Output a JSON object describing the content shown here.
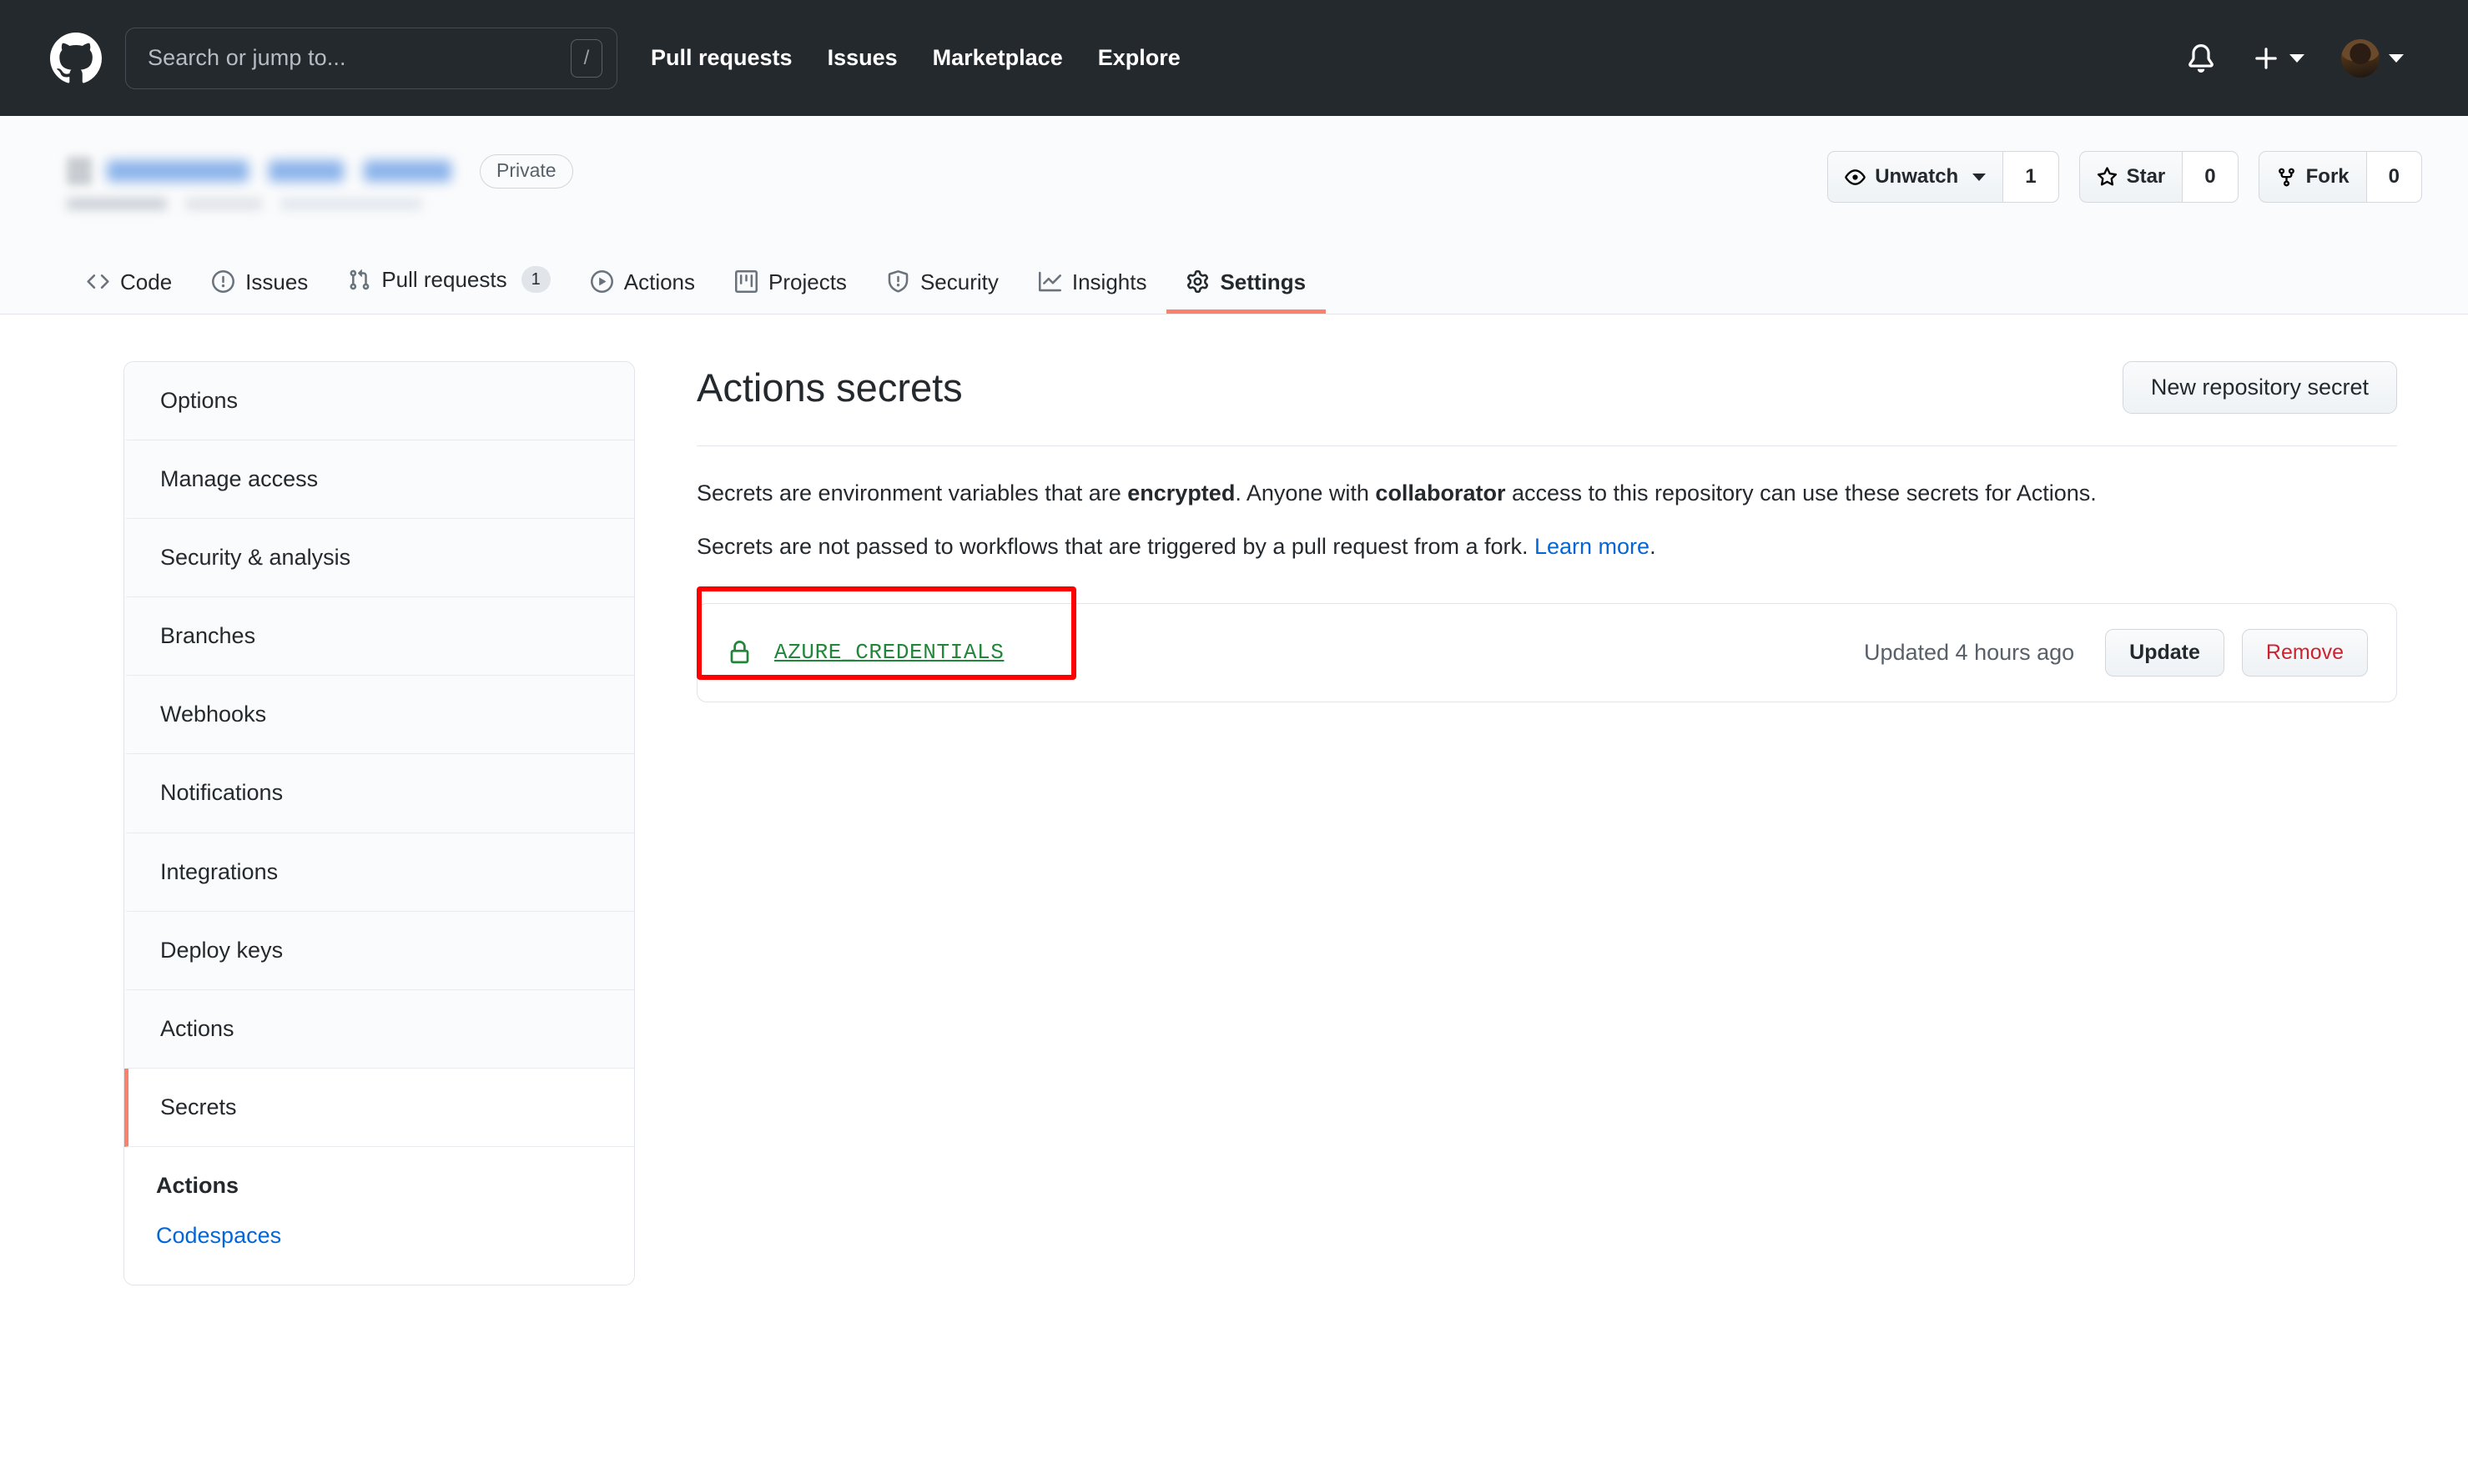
{
  "header": {
    "logo_icon": "github-mark-icon",
    "search": {
      "placeholder": "Search or jump to...",
      "value": "",
      "shortcut_key": "/"
    },
    "nav": [
      {
        "label": "Pull requests"
      },
      {
        "label": "Issues"
      },
      {
        "label": "Marketplace"
      },
      {
        "label": "Explore"
      }
    ],
    "notifications_icon": "bell-icon",
    "create_new_icon": "plus-icon",
    "create_new_caret": "chevron-down-icon",
    "avatar_icon": "user-avatar",
    "avatar_caret": "chevron-down-icon"
  },
  "repo": {
    "visibility_badge": "Private",
    "name_redacted": true,
    "description_redacted": true,
    "actions": [
      {
        "name": "watch",
        "icon": "eye-icon",
        "label": "Unwatch",
        "has_caret": true,
        "count": "1"
      },
      {
        "name": "star",
        "icon": "star-icon",
        "label": "Star",
        "has_caret": false,
        "count": "0"
      },
      {
        "name": "fork",
        "icon": "repo-forked-icon",
        "label": "Fork",
        "has_caret": false,
        "count": "0"
      }
    ],
    "tabs": [
      {
        "label": "Code",
        "icon": "code-icon",
        "badge": "",
        "active": false
      },
      {
        "label": "Issues",
        "icon": "issue-opened-icon",
        "badge": "",
        "active": false
      },
      {
        "label": "Pull requests",
        "icon": "git-pull-request-icon",
        "badge": "1",
        "active": false
      },
      {
        "label": "Actions",
        "icon": "play-icon",
        "badge": "",
        "active": false
      },
      {
        "label": "Projects",
        "icon": "project-icon",
        "badge": "",
        "active": false
      },
      {
        "label": "Security",
        "icon": "shield-icon",
        "badge": "",
        "active": false
      },
      {
        "label": "Insights",
        "icon": "graph-icon",
        "badge": "",
        "active": false
      },
      {
        "label": "Settings",
        "icon": "gear-icon",
        "badge": "",
        "active": true
      }
    ]
  },
  "sidebar": {
    "items": [
      {
        "label": "Options",
        "active": false
      },
      {
        "label": "Manage access",
        "active": false
      },
      {
        "label": "Security & analysis",
        "active": false
      },
      {
        "label": "Branches",
        "active": false
      },
      {
        "label": "Webhooks",
        "active": false
      },
      {
        "label": "Notifications",
        "active": false
      },
      {
        "label": "Integrations",
        "active": false
      },
      {
        "label": "Deploy keys",
        "active": false
      },
      {
        "label": "Actions",
        "active": false
      },
      {
        "label": "Secrets",
        "active": true
      }
    ],
    "sub_section": {
      "title": "Actions",
      "link": "Codespaces"
    }
  },
  "main": {
    "title": "Actions secrets",
    "new_secret_button": "New repository secret",
    "description_1": {
      "part1": "Secrets are environment variables that are ",
      "bold1": "encrypted",
      "part2": ". Anyone with ",
      "bold2": "collaborator",
      "part3": " access to this repository can use these secrets for Actions."
    },
    "description_2": {
      "part1": "Secrets are not passed to workflows that are triggered by a pull request from a fork. ",
      "link": "Learn more",
      "part2": "."
    },
    "secrets": [
      {
        "icon": "lock-icon",
        "name": "AZURE_CREDENTIALS",
        "updated": "Updated 4 hours ago",
        "update_button": "Update",
        "remove_button": "Remove",
        "highlighted": true
      }
    ]
  },
  "colors": {
    "header_bg": "#24292e",
    "accent_orange": "#f9826c",
    "link_blue": "#0366d6",
    "secret_green": "#22863a",
    "danger_red": "#cb2431",
    "annotation_red": "#ff0000",
    "border_gray": "#e1e4e8"
  }
}
